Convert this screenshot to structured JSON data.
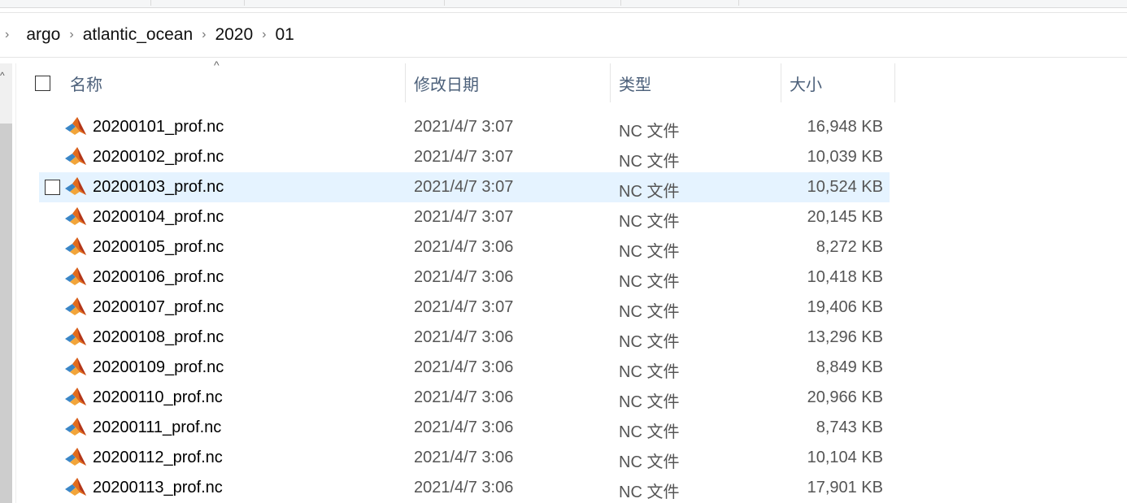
{
  "breadcrumb": [
    "argo",
    "atlantic_ocean",
    "2020",
    "01"
  ],
  "columns": {
    "name": "名称",
    "modified": "修改日期",
    "type": "类型",
    "size": "大小"
  },
  "files": [
    {
      "name": "20200101_prof.nc",
      "modified": "2021/4/7 3:07",
      "type": "NC 文件",
      "size": "16,948 KB"
    },
    {
      "name": "20200102_prof.nc",
      "modified": "2021/4/7 3:07",
      "type": "NC 文件",
      "size": "10,039 KB"
    },
    {
      "name": "20200103_prof.nc",
      "modified": "2021/4/7 3:07",
      "type": "NC 文件",
      "size": "10,524 KB",
      "hovered": true
    },
    {
      "name": "20200104_prof.nc",
      "modified": "2021/4/7 3:07",
      "type": "NC 文件",
      "size": "20,145 KB"
    },
    {
      "name": "20200105_prof.nc",
      "modified": "2021/4/7 3:06",
      "type": "NC 文件",
      "size": "8,272 KB"
    },
    {
      "name": "20200106_prof.nc",
      "modified": "2021/4/7 3:06",
      "type": "NC 文件",
      "size": "10,418 KB"
    },
    {
      "name": "20200107_prof.nc",
      "modified": "2021/4/7 3:07",
      "type": "NC 文件",
      "size": "19,406 KB"
    },
    {
      "name": "20200108_prof.nc",
      "modified": "2021/4/7 3:06",
      "type": "NC 文件",
      "size": "13,296 KB"
    },
    {
      "name": "20200109_prof.nc",
      "modified": "2021/4/7 3:06",
      "type": "NC 文件",
      "size": "8,849 KB"
    },
    {
      "name": "20200110_prof.nc",
      "modified": "2021/4/7 3:06",
      "type": "NC 文件",
      "size": "20,966 KB"
    },
    {
      "name": "20200111_prof.nc",
      "modified": "2021/4/7 3:06",
      "type": "NC 文件",
      "size": "8,743 KB"
    },
    {
      "name": "20200112_prof.nc",
      "modified": "2021/4/7 3:06",
      "type": "NC 文件",
      "size": "10,104 KB"
    },
    {
      "name": "20200113_prof.nc",
      "modified": "2021/4/7 3:06",
      "type": "NC 文件",
      "size": "17,901 KB"
    }
  ],
  "icons": {
    "file": "matlab-file-icon",
    "sort": "sort-ascending-icon",
    "separator": "chevron-right-icon"
  },
  "colors": {
    "hover": "#e5f3ff",
    "header_text": "#4c607a"
  }
}
